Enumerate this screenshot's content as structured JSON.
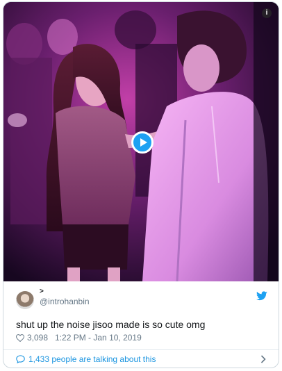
{
  "tweet": {
    "display_name": "˃",
    "handle": "@introhanbin",
    "text": "shut up the noise jisoo made is so cute omg",
    "likes": "3,098",
    "timestamp": "1:22 PM - Jan 10, 2019",
    "conversation_text": "1,433 people are talking about this"
  },
  "media": {
    "info_icon_glyph": "i",
    "play_icon": "play-icon"
  },
  "colors": {
    "twitter_blue": "#1da1f2",
    "link_blue": "#1b95e0",
    "secondary_text": "#657786",
    "primary_text": "#14171a"
  }
}
